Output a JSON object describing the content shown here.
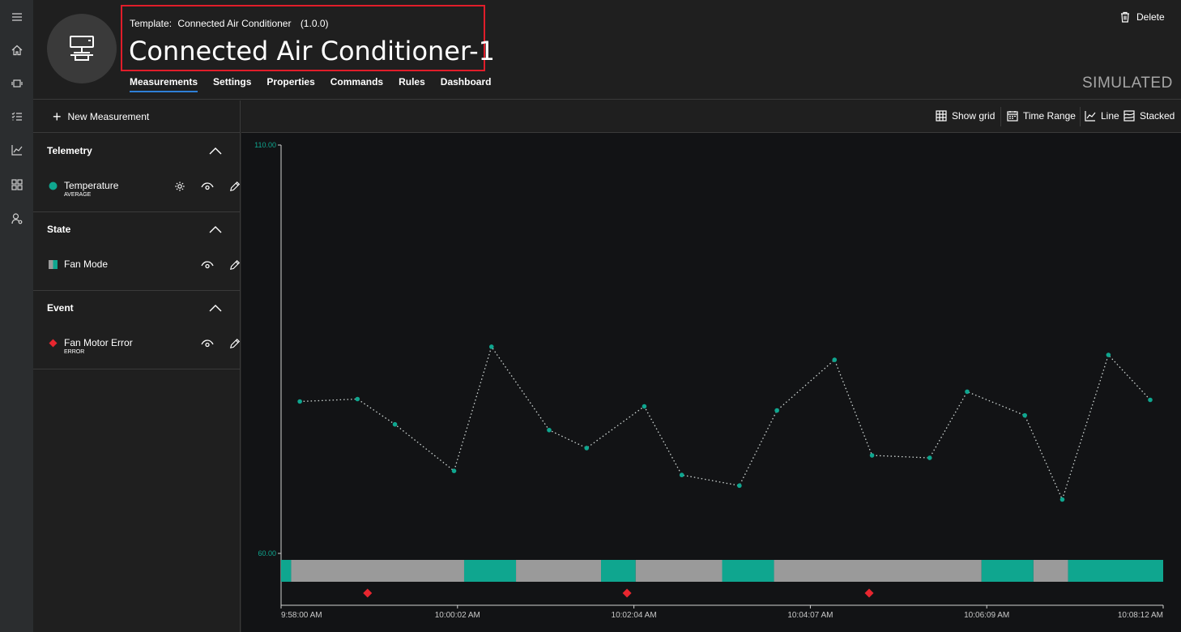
{
  "rail": {
    "icons": [
      "hamburger-menu-icon",
      "home-icon",
      "devices-icon",
      "list-check-icon",
      "analytics-icon",
      "dashboard-grid-icon",
      "user-admin-icon"
    ]
  },
  "header": {
    "template_label": "Template:",
    "template_name": "Connected Air Conditioner",
    "template_version": "(1.0.0)",
    "device_name": "Connected Air Conditioner-1",
    "tabs": [
      "Measurements",
      "Settings",
      "Properties",
      "Commands",
      "Rules",
      "Dashboard"
    ],
    "active_tab": "Measurements",
    "delete_label": "Delete",
    "status": "SIMULATED"
  },
  "left": {
    "new_measurement": "New Measurement",
    "sections": [
      {
        "title": "Telemetry",
        "item": {
          "label": "Temperature",
          "sub": "AVERAGE",
          "color": "#0fa68f",
          "mark": "circle"
        }
      },
      {
        "title": "State",
        "item": {
          "label": "Fan Mode",
          "sub": "",
          "color": "#0fa68f",
          "mark": "square"
        }
      },
      {
        "title": "Event",
        "item": {
          "label": "Fan Motor Error",
          "sub": "ERROR",
          "color": "#e8262f",
          "mark": "diamond"
        }
      }
    ]
  },
  "toolbar": {
    "show_grid": "Show grid",
    "time_range": "Time Range",
    "line": "Line",
    "stacked": "Stacked"
  },
  "colors": {
    "accent": "#0fa68f",
    "state_grey": "#9a9a9a",
    "event_red": "#e8262f",
    "highlight_box": "#e01d2a",
    "active_tab_underline": "#2e7fd6"
  },
  "chart_data": {
    "type": "line",
    "y_top_label": "110.00",
    "y_bottom_label": "60.00",
    "ylim": [
      60,
      110
    ],
    "x_tick_labels": [
      "9:58:00 AM",
      "10:00:02 AM",
      "10:02:04 AM",
      "10:04:07 AM",
      "10:06:09 AM",
      "10:08:12 AM"
    ],
    "x_range_seconds": [
      0,
      612
    ],
    "series": [
      {
        "name": "Temperature",
        "color": "#0fa68f",
        "x_seconds": [
          13,
          53,
          79,
          120,
          146,
          186,
          212,
          252,
          278,
          318,
          344,
          384,
          410,
          450,
          476,
          516,
          542,
          574,
          603
        ],
        "values": [
          78.6,
          78.9,
          75.8,
          70.1,
          85.3,
          75.1,
          72.9,
          78.0,
          69.6,
          68.3,
          77.5,
          83.7,
          72.0,
          71.7,
          79.8,
          76.9,
          66.6,
          84.3,
          78.8
        ]
      }
    ],
    "state_series": {
      "name": "Fan Mode",
      "segments": [
        {
          "start": 0,
          "end": 7,
          "state": "on"
        },
        {
          "start": 7,
          "end": 127,
          "state": "off"
        },
        {
          "start": 127,
          "end": 163,
          "state": "on"
        },
        {
          "start": 163,
          "end": 222,
          "state": "off"
        },
        {
          "start": 222,
          "end": 246,
          "state": "on"
        },
        {
          "start": 246,
          "end": 306,
          "state": "off"
        },
        {
          "start": 306,
          "end": 342,
          "state": "on"
        },
        {
          "start": 342,
          "end": 486,
          "state": "off"
        },
        {
          "start": 486,
          "end": 522,
          "state": "on"
        },
        {
          "start": 522,
          "end": 546,
          "state": "off"
        },
        {
          "start": 546,
          "end": 612,
          "state": "on"
        }
      ]
    },
    "events": {
      "name": "Fan Motor Error",
      "x_seconds": [
        60,
        240,
        408
      ]
    }
  }
}
